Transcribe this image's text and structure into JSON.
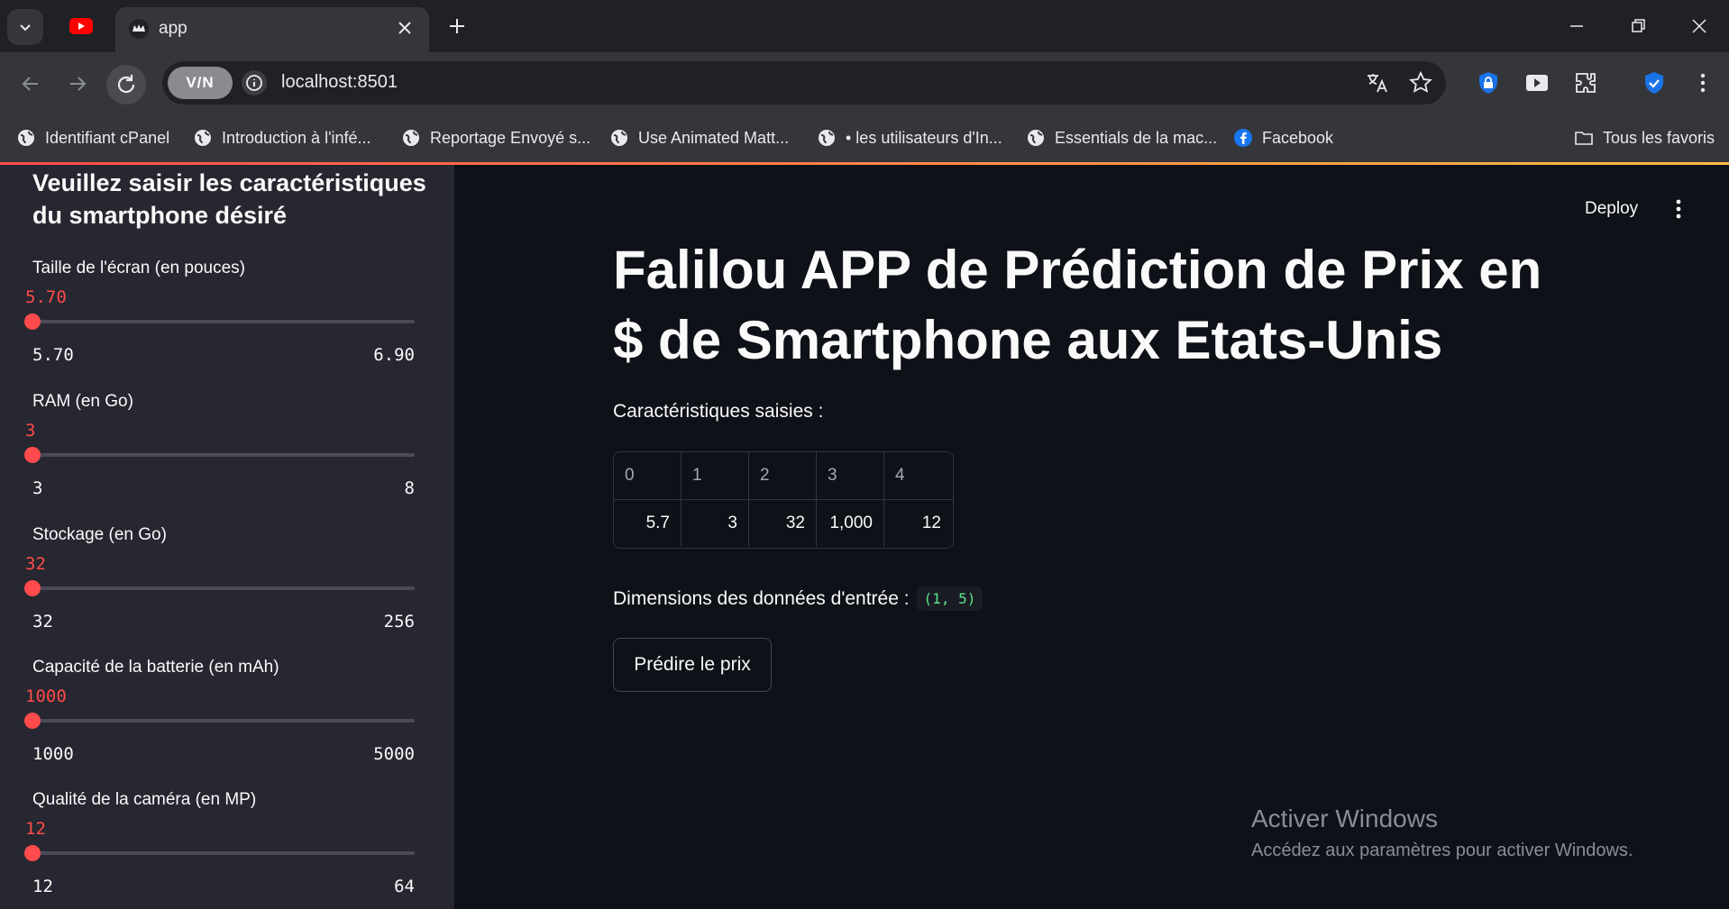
{
  "browser": {
    "active_tab_title": "app",
    "url": "localhost:8501",
    "vpn_label": "V/N",
    "bookmarks": [
      {
        "label": "Identifiant cPanel",
        "icon": "globe-icon"
      },
      {
        "label": "Introduction à l'infé...",
        "icon": "globe-icon"
      },
      {
        "label": "Reportage Envoyé s...",
        "icon": "globe-icon"
      },
      {
        "label": "Use Animated Matt...",
        "icon": "globe-icon"
      },
      {
        "label": "• les utilisateurs d'In...",
        "icon": "globe-icon"
      },
      {
        "label": "Essentials de la mac...",
        "icon": "globe-icon"
      },
      {
        "label": "Facebook",
        "icon": "facebook-icon"
      }
    ],
    "all_bookmarks_label": "Tous les favoris",
    "colors": {
      "youtube": "#ff0000",
      "accent_start": "#ff4b4b",
      "accent_end": "#ffbd45",
      "shield": "#1a73e8"
    }
  },
  "sidebar": {
    "heading": "Veuillez saisir les caractéristiques du smartphone désiré",
    "sliders": [
      {
        "label": "Taille de l'écran (en pouces)",
        "value": "5.70",
        "min": "5.70",
        "max": "6.90"
      },
      {
        "label": "RAM (en Go)",
        "value": "3",
        "min": "3",
        "max": "8"
      },
      {
        "label": "Stockage (en Go)",
        "value": "32",
        "min": "32",
        "max": "256"
      },
      {
        "label": "Capacité de la batterie (en mAh)",
        "value": "1000",
        "min": "1000",
        "max": "5000"
      },
      {
        "label": "Qualité de la caméra (en MP)",
        "value": "12",
        "min": "12",
        "max": "64"
      }
    ]
  },
  "main": {
    "deploy_label": "Deploy",
    "title": "Falilou APP de Prédiction de Prix en $ de Smartphone aux Etats-Unis",
    "features_caption": "Caractéristiques saisies :",
    "table": {
      "headers": [
        "0",
        "1",
        "2",
        "3",
        "4"
      ],
      "row": [
        "5.7",
        "3",
        "32",
        "1,000",
        "12"
      ]
    },
    "dims_label": "Dimensions des données d'entrée :",
    "dims_value": "(1, 5)",
    "predict_button": "Prédire le prix",
    "accent_color": "#ff4b4b"
  },
  "watermark": {
    "title": "Activer Windows",
    "subtitle": "Accédez aux paramètres pour activer Windows."
  }
}
